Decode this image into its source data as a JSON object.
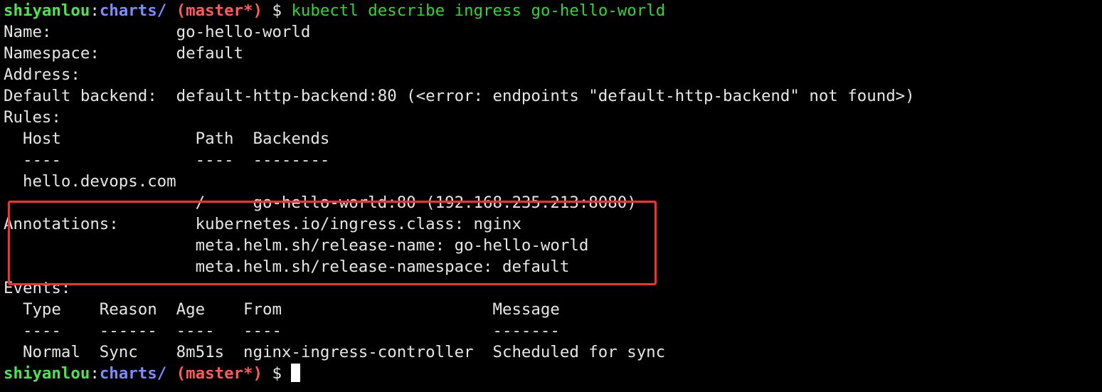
{
  "prompt": {
    "user": "shiyanlou",
    "separator": ":",
    "dir": "charts/",
    "branch": "(master*)",
    "dollar": "$"
  },
  "command": "kubectl describe ingress go-hello-world",
  "lines": [
    "Name:             go-hello-world",
    "Namespace:        default",
    "Address:",
    "Default backend:  default-http-backend:80 (<error: endpoints \"default-http-backend\" not found>)",
    "Rules:",
    "  Host              Path  Backends",
    "  ----              ----  --------",
    "  hello.devops.com",
    "                    /     go-hello-world:80 (192.168.235.213:8080)",
    "Annotations:        kubernetes.io/ingress.class: nginx",
    "                    meta.helm.sh/release-name: go-hello-world",
    "                    meta.helm.sh/release-namespace: default",
    "Events:",
    "  Type    Reason  Age    From                      Message",
    "  ----    ------  ----   ----                      -------",
    "  Normal  Sync    8m51s  nginx-ingress-controller  Scheduled for sync"
  ],
  "colors": {
    "background": "#000000",
    "text": "#e6e6e6",
    "user": "#4ee44e",
    "dir": "#7a8cff",
    "branch": "#ff5a5a",
    "command": "#35d435",
    "highlight_box": "#ff2a2a"
  }
}
